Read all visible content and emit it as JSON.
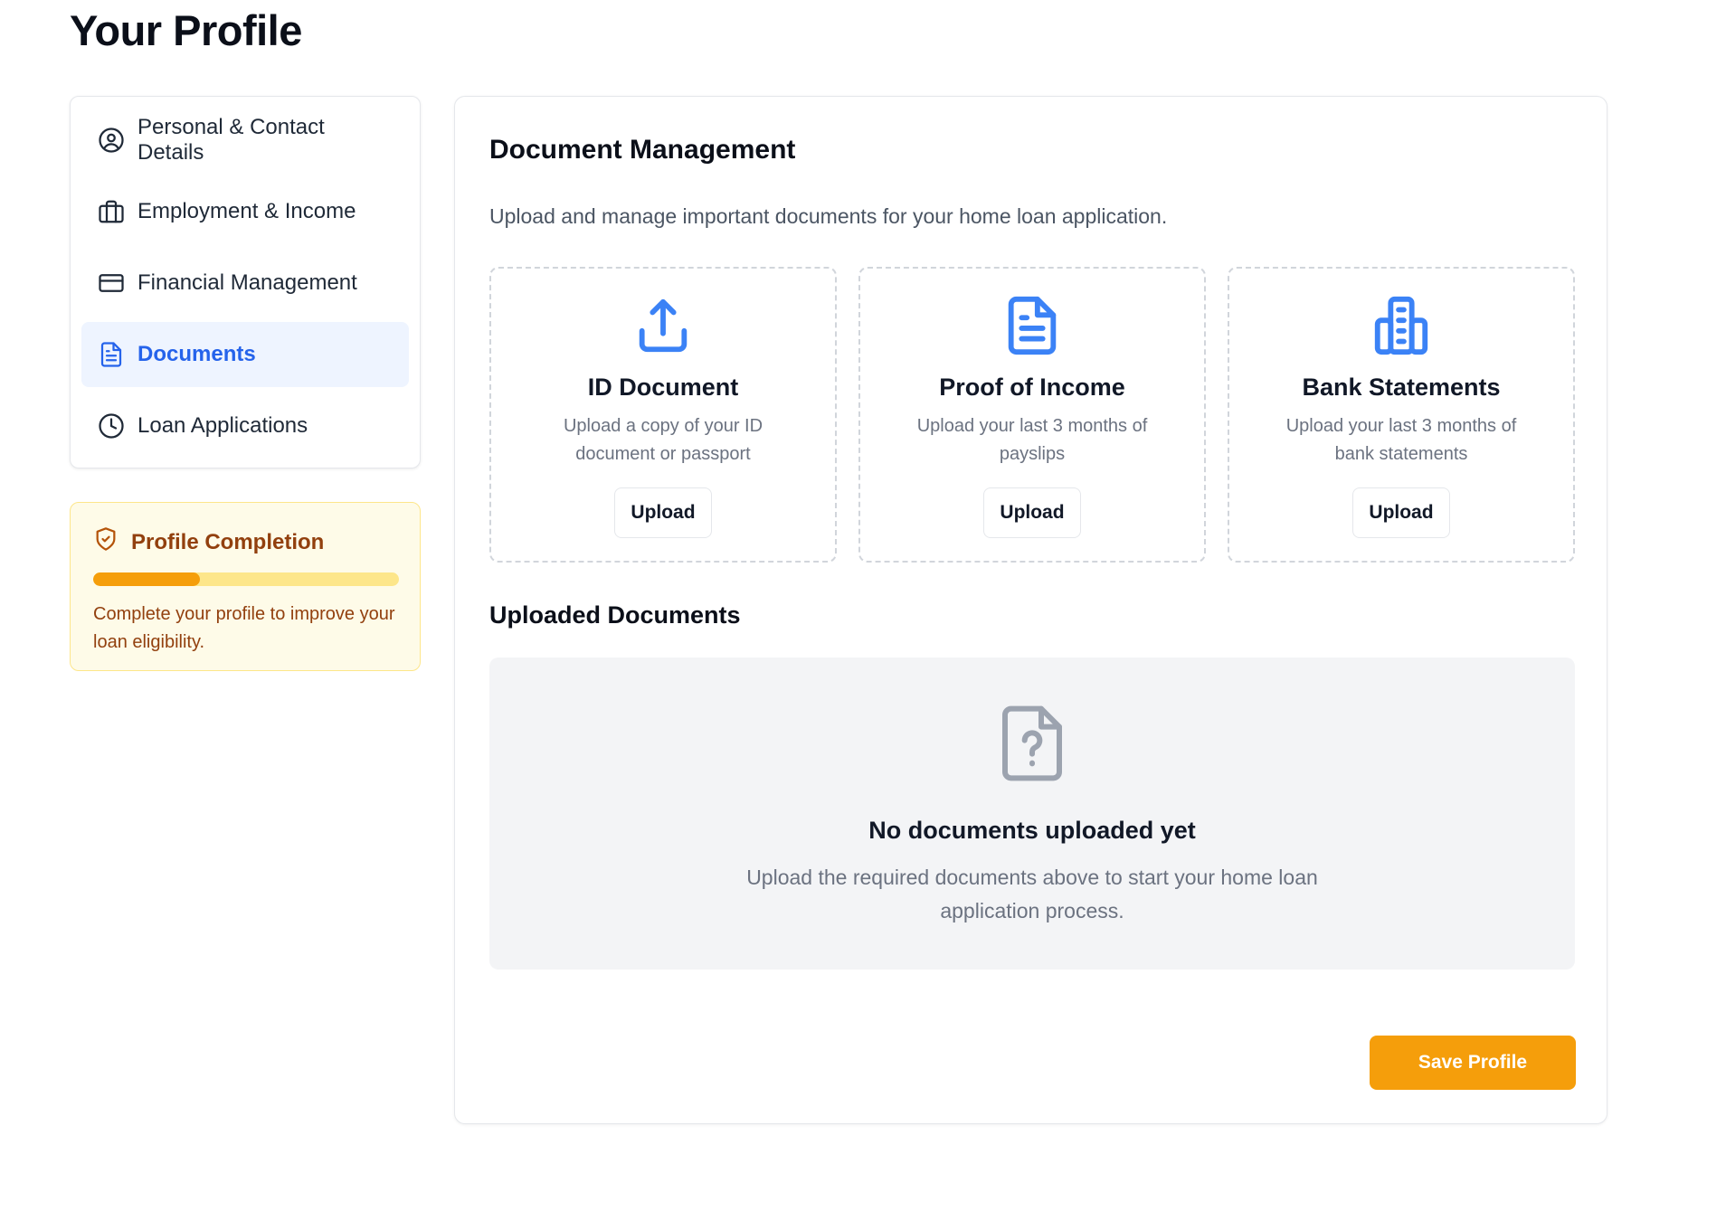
{
  "page": {
    "title": "Your Profile"
  },
  "sidebar": {
    "items": [
      {
        "label": "Personal & Contact Details",
        "icon": "user-circle-icon",
        "active": false
      },
      {
        "label": "Employment & Income",
        "icon": "briefcase-icon",
        "active": false
      },
      {
        "label": "Financial Management",
        "icon": "credit-card-icon",
        "active": false
      },
      {
        "label": "Documents",
        "icon": "document-icon",
        "active": true
      },
      {
        "label": "Loan Applications",
        "icon": "clock-icon",
        "active": false
      }
    ]
  },
  "completion": {
    "title": "Profile Completion",
    "icon": "shield-check-icon",
    "progress_fraction": 0.35,
    "text": "Complete your profile to improve your loan eligibility."
  },
  "main": {
    "title": "Document Management",
    "description": "Upload and manage important documents for your home loan application.",
    "upload_cards": [
      {
        "title": "ID Document",
        "description": "Upload a copy of your ID document or passport",
        "button": "Upload",
        "icon": "upload-icon"
      },
      {
        "title": "Proof of Income",
        "description": "Upload your last 3 months of payslips",
        "button": "Upload",
        "icon": "file-text-icon"
      },
      {
        "title": "Bank Statements",
        "description": "Upload your last 3 months of bank statements",
        "button": "Upload",
        "icon": "bank-building-icon"
      }
    ],
    "uploaded_title": "Uploaded Documents",
    "empty": {
      "icon": "file-question-icon",
      "title": "No documents uploaded yet",
      "description": "Upload the required documents above to start your home loan application process."
    },
    "save_button": "Save Profile"
  },
  "colors": {
    "accent_blue": "#2563eb",
    "icon_blue": "#3b82f6",
    "accent_orange": "#f59e0b",
    "active_bg": "#eef4ff",
    "completion_bg": "#fefbe8",
    "completion_text": "#92400e"
  }
}
